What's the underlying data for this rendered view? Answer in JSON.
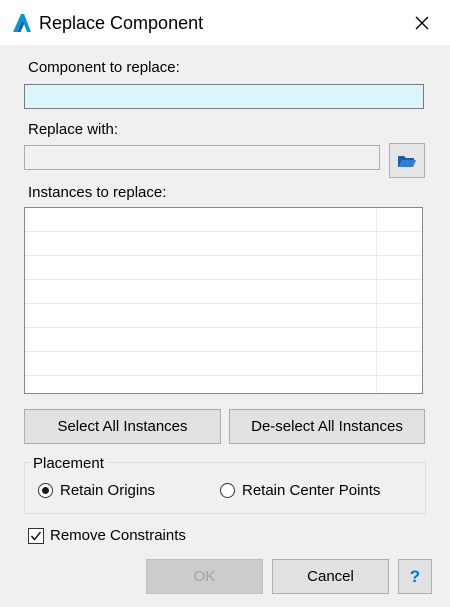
{
  "window": {
    "title": "Replace Component",
    "icon": "autodesk-logo-icon",
    "close_icon": "close-icon"
  },
  "component_to_replace": {
    "label": "Component to replace:",
    "value": ""
  },
  "replace_with": {
    "label": "Replace with:",
    "value": "",
    "browse_icon": "folder-open-icon"
  },
  "instances": {
    "label": "Instances to replace:",
    "rows": [
      "",
      "",
      "",
      "",
      "",
      "",
      "",
      ""
    ]
  },
  "buttons": {
    "select_all": "Select All Instances",
    "deselect_all": "De-select All Instances",
    "ok": "OK",
    "cancel": "Cancel",
    "help": "?"
  },
  "placement": {
    "title": "Placement",
    "options": [
      {
        "label": "Retain Origins",
        "selected": true
      },
      {
        "label": "Retain Center Points",
        "selected": false
      }
    ]
  },
  "remove_constraints": {
    "label": "Remove Constraints",
    "checked": true
  },
  "colors": {
    "accent": "#0078d7",
    "active_field": "#dcf5fb",
    "folder": "#1e5aa8"
  }
}
